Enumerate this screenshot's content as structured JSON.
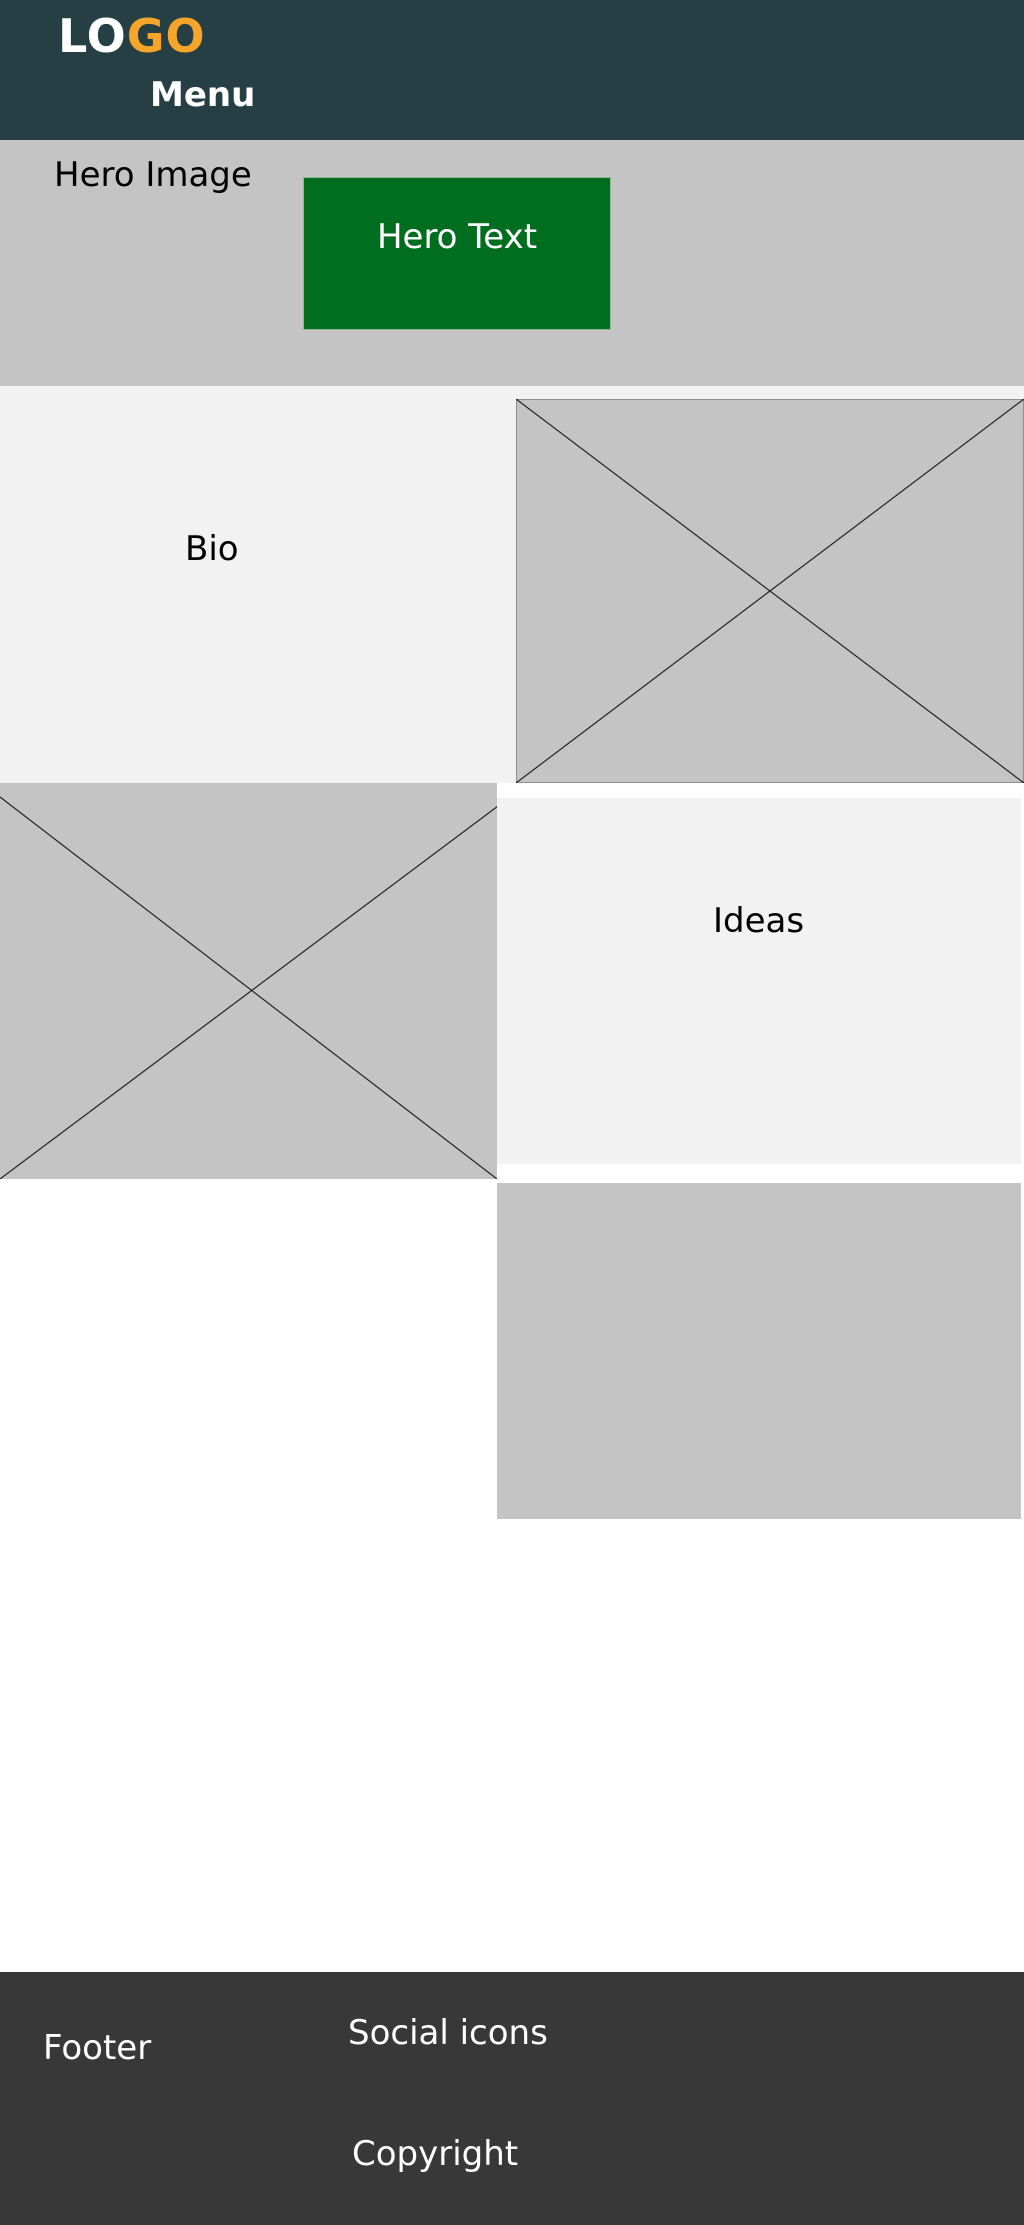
{
  "header": {
    "logo_part1": "LO",
    "logo_part2": "GO",
    "menu_label": "Menu"
  },
  "hero": {
    "image_label": "Hero Image",
    "text_label": "Hero Text"
  },
  "sections": {
    "bio_label": "Bio",
    "ideas_label": "Ideas"
  },
  "footer": {
    "footer_label": "Footer",
    "social_label": "Social icons",
    "copyright_label": "Copyright"
  },
  "colors": {
    "header_bg": "#253f44",
    "logo_accent": "#f4a52a",
    "hero_text_bg": "#016d1e",
    "placeholder_grey": "#c4c4c4",
    "section_bg": "#f2f2f2",
    "footer_bg": "#383838"
  },
  "icons": {
    "image_placeholder": "image-placeholder-icon"
  }
}
